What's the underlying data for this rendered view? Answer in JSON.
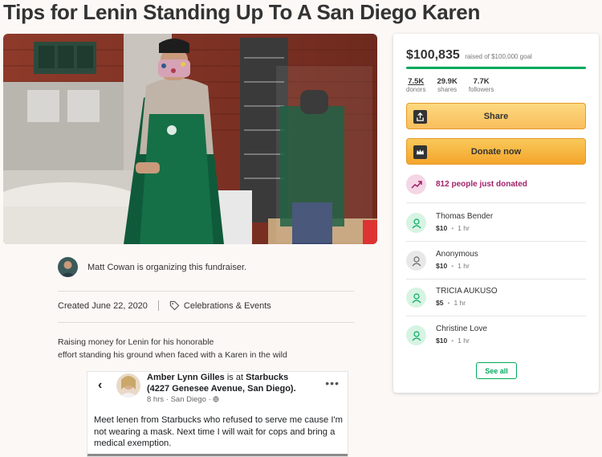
{
  "page": {
    "title": "Tips for Lenin Standing Up To A San Diego Karen"
  },
  "organizer": {
    "text": "Matt Cowan is organizing this fundraiser."
  },
  "meta": {
    "created": "Created June 22, 2020",
    "category": "Celebrations & Events"
  },
  "description": {
    "line1": "Raising money for Lenin for his honorable",
    "line2": "effort standing his ground when faced with a Karen in the wild"
  },
  "post": {
    "author": "Amber Lynn Gilles",
    "connector": " is at ",
    "place": "Starbucks",
    "address": "(4227 Genesee Avenue, San Diego).",
    "time": "8 hrs",
    "location": "San Diego",
    "body": "Meet lenen from Starbucks who refused to serve me cause I'm not wearing a mask. Next time I will wait for cops and bring a medical exemption."
  },
  "panel": {
    "amount": "$100,835",
    "goal_text": "raised of $100,000 goal",
    "progress_fraction": 1.0,
    "stats": [
      {
        "num": "7.5K",
        "label": "donors"
      },
      {
        "num": "29.9K",
        "label": "shares"
      },
      {
        "num": "7.7K",
        "label": "followers"
      }
    ],
    "share_label": "Share",
    "donate_label": "Donate now",
    "trend_text": "812 people just donated",
    "donations": [
      {
        "name": "Thomas Bender",
        "amount": "$10",
        "time": "1 hr",
        "icon_color": "#d7f3e3"
      },
      {
        "name": "Anonymous",
        "amount": "$10",
        "time": "1 hr",
        "icon_color": "#e8e8e8"
      },
      {
        "name": "TRICIA AUKUSO",
        "amount": "$5",
        "time": "1 hr",
        "icon_color": "#d7f3e3"
      },
      {
        "name": "Christine Love",
        "amount": "$10",
        "time": "1 hr",
        "icon_color": "#d7f3e3"
      }
    ],
    "see_all_label": "See all"
  },
  "colors": {
    "brand_green": "#02a95c",
    "donate_orange": "#f4a52b",
    "trend_magenta": "#a2226a"
  }
}
